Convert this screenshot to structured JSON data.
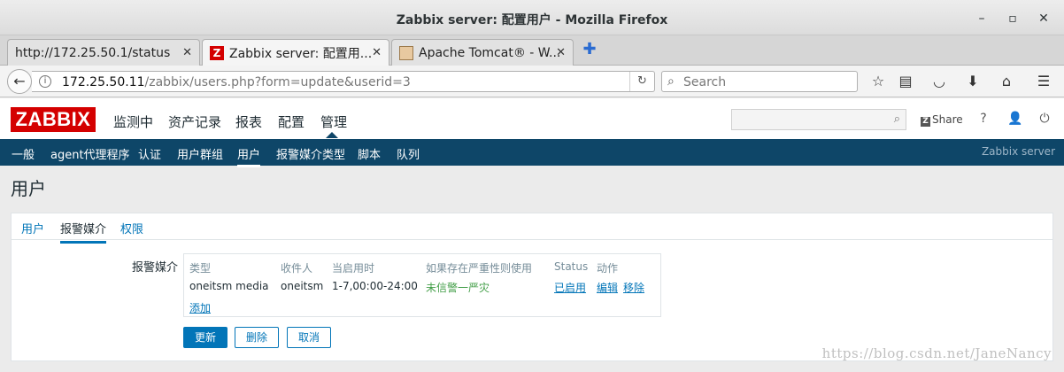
{
  "window": {
    "title": "Zabbix server: 配置用户 - Mozilla Firefox"
  },
  "tabs": [
    {
      "label": "http://172.25.50.1/status",
      "favicon": "none"
    },
    {
      "label": "Zabbix server: 配置用...",
      "favicon": "zabbix-icon"
    },
    {
      "label": "Apache Tomcat® - W...",
      "favicon": "tomcat-icon"
    }
  ],
  "nav": {
    "url_host": "172.25.50.11",
    "url_path": "/zabbix/users.php?form=update&userid=3",
    "search_placeholder": "Search"
  },
  "zabbix": {
    "logo": "ZABBIX",
    "menu": [
      "监测中",
      "资产记录",
      "报表",
      "配置",
      "管理"
    ],
    "share": "Share",
    "help": "?",
    "submenu": [
      "一般",
      "agent代理程序",
      "认证",
      "用户群组",
      "用户",
      "报警媒介类型",
      "脚本",
      "队列"
    ],
    "server_name": "Zabbix server"
  },
  "page": {
    "title": "用户",
    "form_tabs": [
      "用户",
      "报警媒介",
      "权限"
    ],
    "media_label": "报警媒介",
    "media_table": {
      "headers": [
        "类型",
        "收件人",
        "当启用时",
        "如果存在严重性则使用",
        "Status",
        "动作"
      ],
      "row": {
        "type": "oneitsm media",
        "recipient": "oneitsm",
        "when_active": "1-7,00:00-24:00",
        "severity": "未信警一严灾",
        "status": "已启用",
        "edit": "编辑",
        "remove": "移除"
      },
      "add": "添加"
    },
    "buttons": {
      "update": "更新",
      "delete": "删除",
      "cancel": "取消"
    }
  },
  "watermark": "https://blog.csdn.net/JaneNancy",
  "colors": {
    "brand_red": "#d40000",
    "subnav_bg": "#0e4668",
    "link_blue": "#0275b8",
    "enabled_green": "#429e47"
  }
}
